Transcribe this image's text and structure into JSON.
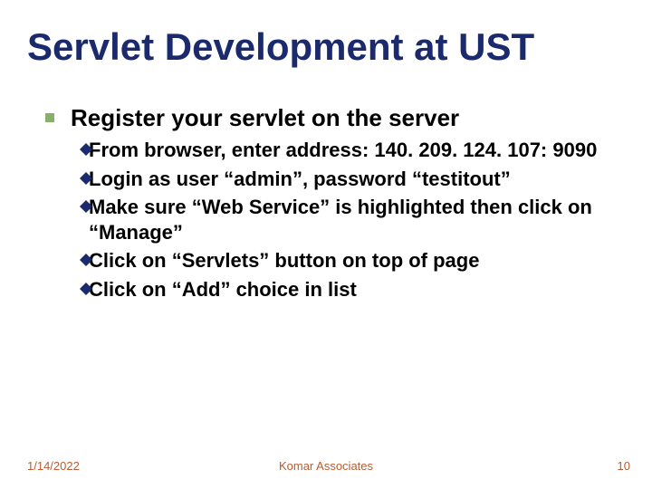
{
  "title": "Servlet Development at UST",
  "level1_text": "Register your servlet on the server",
  "bullets": [
    {
      "lead": "From",
      "rest": " browser, enter address: 140. 209. 124. 107: 9090"
    },
    {
      "lead": "Login",
      "rest": " as user “admin”, password “testitout”"
    },
    {
      "lead": "Make",
      "rest": " sure “Web Service” is highlighted then click on “Manage”"
    },
    {
      "lead": "Click",
      "rest": " on “Servlets” button on top of page"
    },
    {
      "lead": "Click",
      "rest": " on “Add” choice in list"
    }
  ],
  "footer": {
    "date": "1/14/2022",
    "author": "Komar Associates",
    "page": "10"
  },
  "colors": {
    "title": "#1a2a6c",
    "square_bullet": "#88b06a",
    "diamond_bullet": "#1a2a6c",
    "footer": "#b85c2e"
  }
}
